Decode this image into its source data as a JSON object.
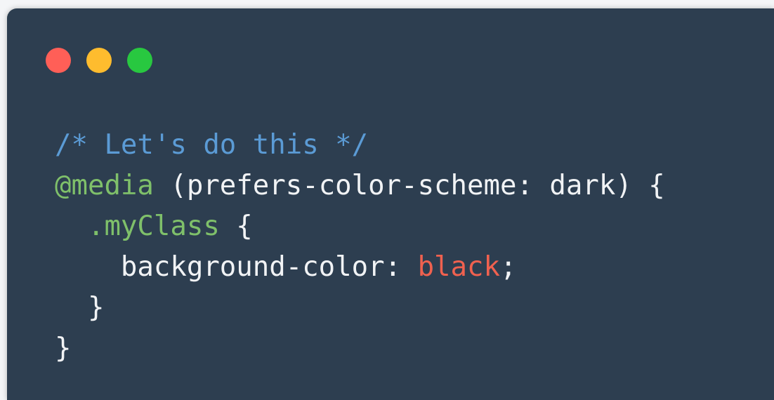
{
  "window": {
    "controls": {
      "close_color": "#ff5f57",
      "minimize_color": "#febc2e",
      "maximize_color": "#28c840"
    }
  },
  "code": {
    "line1": {
      "comment": "/* Let's do this */"
    },
    "line2": {
      "at": "@media",
      "rest": " (prefers-color-scheme: dark) {"
    },
    "line3": {
      "indent": "  ",
      "selector": ".myClass",
      "rest": " {"
    },
    "line4": {
      "indent": "    ",
      "property": "background-color: ",
      "value": "black",
      "end": ";"
    },
    "line5": {
      "text": "  }"
    },
    "line6": {
      "text": "}"
    }
  },
  "colors": {
    "background": "#2d3e50",
    "comment": "#5b9bd5",
    "keyword": "#7fc06a",
    "text": "#f1f3f5",
    "value": "#f0614f"
  }
}
